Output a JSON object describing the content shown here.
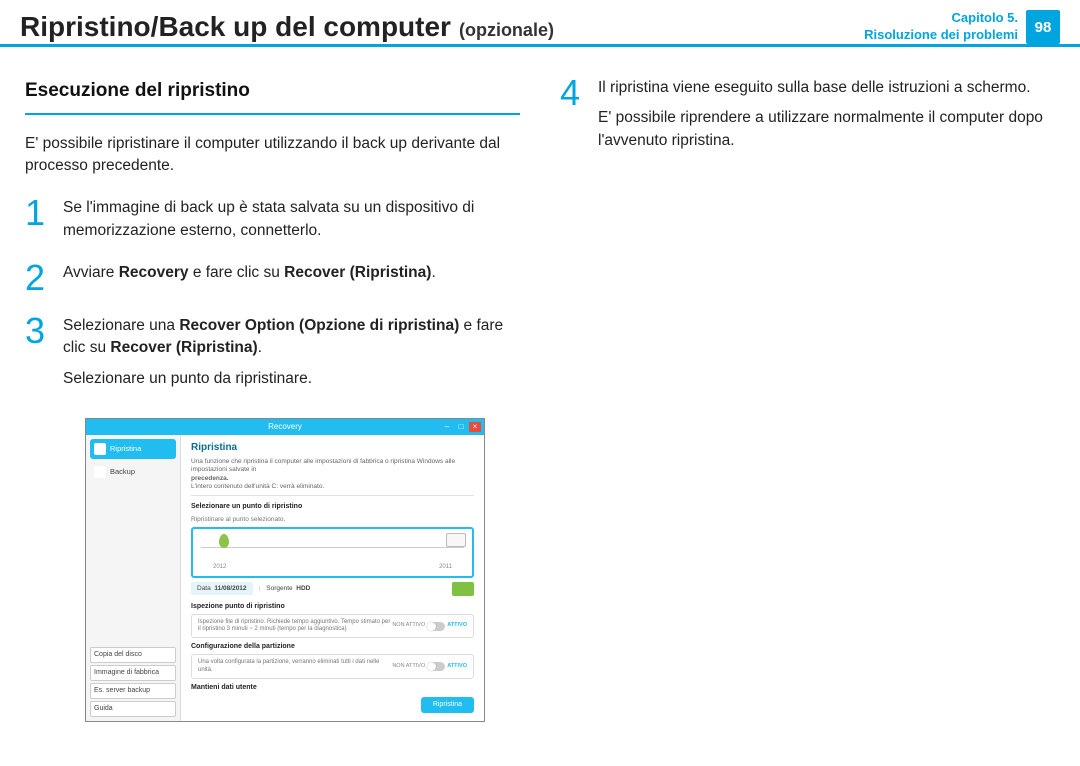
{
  "header": {
    "title_main": "Ripristino/Back up del computer",
    "title_sub": "(opzionale)",
    "chapter_line1": "Capitolo 5.",
    "chapter_line2": "Risoluzione dei problemi",
    "page_num": "98"
  },
  "left": {
    "section_heading": "Esecuzione del ripristino",
    "intro": "E' possibile ripristinare il computer utilizzando il back up derivante dal processo precedente.",
    "step1_text": "Se l'immagine di back up è stata salvata su un dispositivo di memorizzazione esterno, connetterlo.",
    "step2_a": "Avviare ",
    "step2_b": "Recovery",
    "step2_c": " e fare clic su ",
    "step2_d": "Recover (Ripristina)",
    "step2_e": ".",
    "step3_a": "Selezionare una ",
    "step3_b": "Recover Option (Opzione di ripristina)",
    "step3_c": " e fare clic su ",
    "step3_d": "Recover (Ripristina)",
    "step3_e": ".",
    "step3_sub": "Selezionare un punto da ripristinare."
  },
  "right": {
    "step4_text": "Il ripristina viene eseguito sulla base delle istruzioni a schermo.",
    "step4_sub": "E' possibile riprendere a utilizzare normalmente il computer dopo l'avvenuto ripristina."
  },
  "app": {
    "title": "Recovery",
    "sidebar": {
      "item_restore": "Ripristina",
      "item_backup": "Backup",
      "btn_copy": "Copia del disco",
      "btn_factory": "Immagine di fabbrica",
      "btn_server": "Es. server backup",
      "btn_help": "Guida"
    },
    "main": {
      "heading": "Ripristina",
      "desc_l1": "Una funzione che ripristina il computer alle impostazioni di fabbrica o ripristina Windows alle impostazioni salvate in",
      "desc_l2": "precedenza.",
      "desc_l3": "L'intero contenuto dell'unità C: verrà eliminato.",
      "sec1_label": "Selezionare un punto di ripristino",
      "sec1_sub": "Ripristinare al punto selezionato.",
      "year_left": "2012",
      "year_right": "2011",
      "meta_date_label": "Data",
      "meta_date": "11/08/2012",
      "meta_src_label": "Sorgente",
      "meta_src": "HDD",
      "sec2_label": "Ispezione punto di ripristino",
      "opt1_text": "Ispezione file di ripristino. Richiede tempo aggiuntivo. Tempo stimato per il ripristino 3 minuti ~ 2 minuti (tempo per la diagnostica)",
      "sec3_label": "Configurazione della partizione",
      "opt2_text": "Una volta configurata la partizione, verranno eliminati tutti i dati nelle unità.",
      "toggle_off": "NON ATTIVO",
      "toggle_on": "ATTIVO",
      "sec4_label": "Mantieni dati utente",
      "action_btn": "Ripristina"
    }
  }
}
